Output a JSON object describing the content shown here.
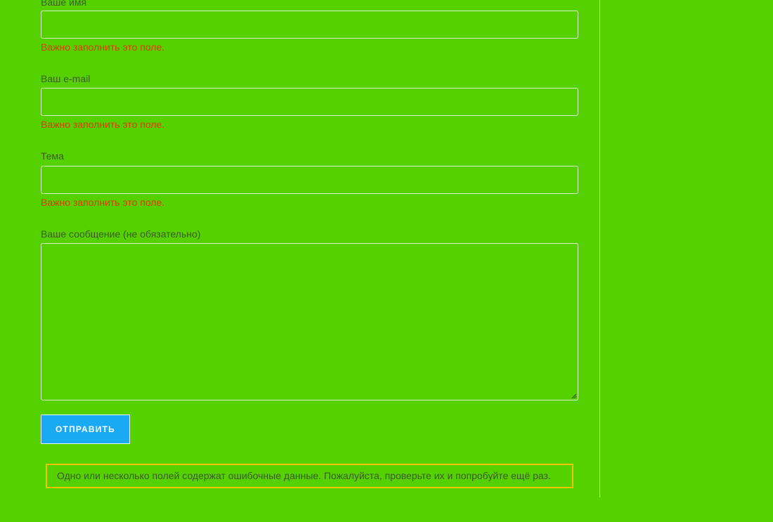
{
  "form": {
    "name_label": "Ваше имя",
    "name_value": "",
    "name_error": "Важно заполнить это поле.",
    "email_label": "Ваш e-mail",
    "email_value": "",
    "email_error": "Важно заполнить это поле.",
    "subject_label": "Тема",
    "subject_value": "",
    "subject_error": "Важно заполнить это поле.",
    "message_label": "Ваше сообщение (не обязательно)",
    "message_value": "",
    "submit_label": "ОТПРАВИТЬ"
  },
  "response": {
    "message": "Одно или несколько полей содержат ошибочные данные. Пожалуйста, проверьте их и попробуйте ещё раз."
  },
  "colors": {
    "background": "#55d100",
    "error_text": "#e03a00",
    "submit_button": "#19aaf3",
    "response_border": "#f0c400"
  }
}
